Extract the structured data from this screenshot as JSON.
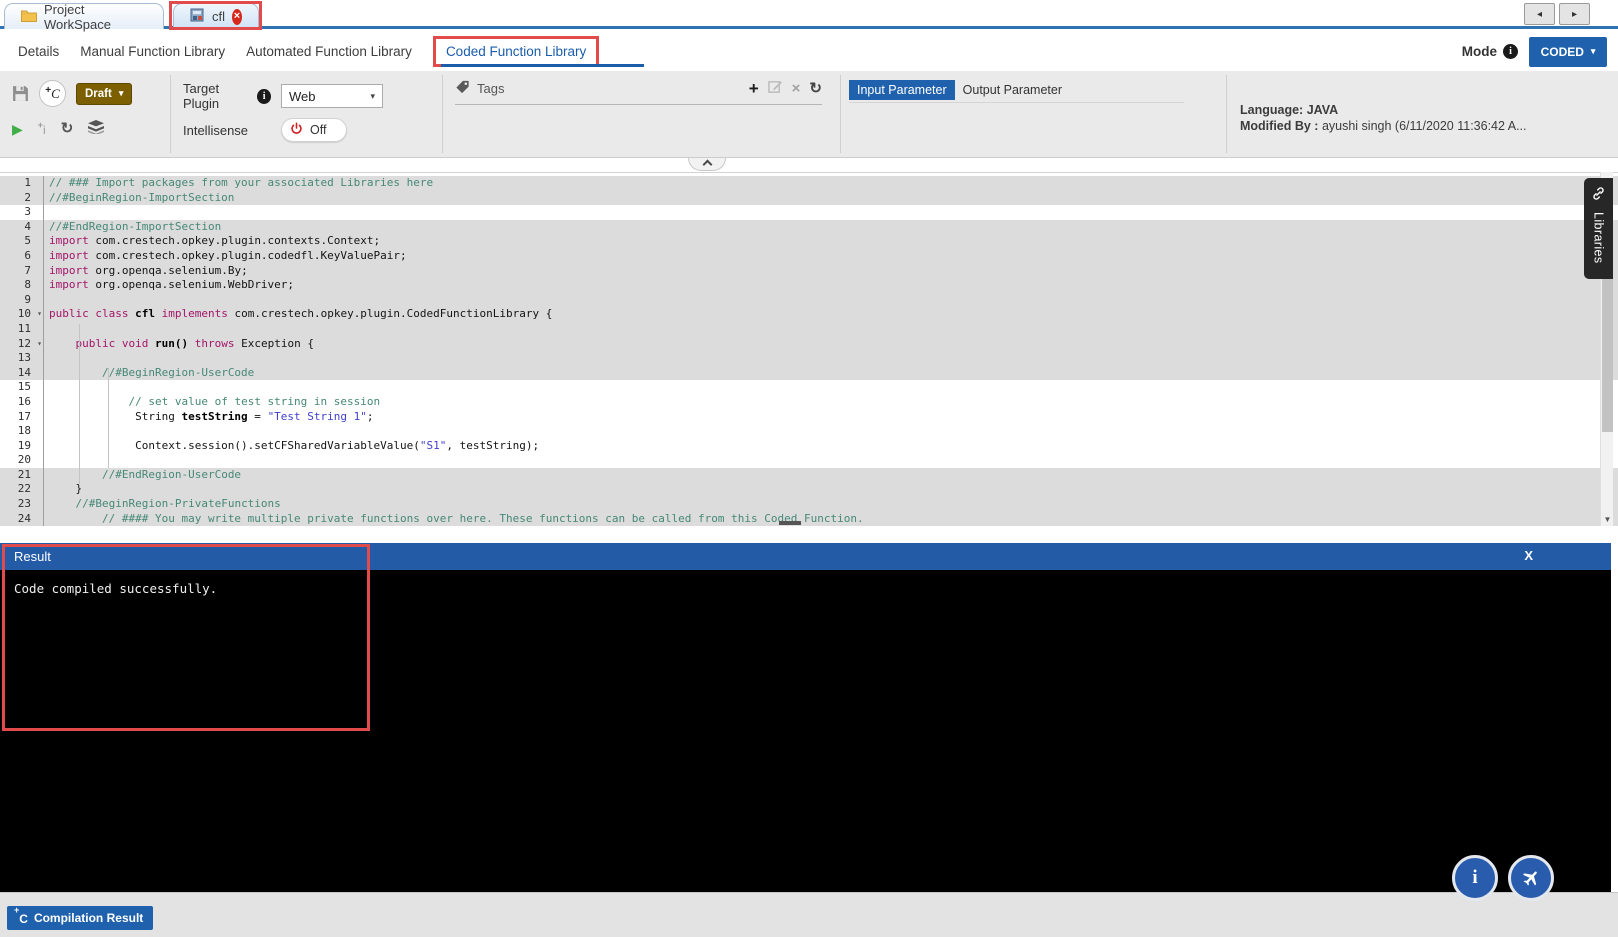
{
  "tab_bar": {
    "workspace_tab": "Project WorkSpace",
    "cfl_tab": "cfl"
  },
  "nav": {
    "items": [
      {
        "label": "Details"
      },
      {
        "label": "Manual Function Library"
      },
      {
        "label": "Automated Function Library"
      },
      {
        "label": "Coded Function Library"
      }
    ],
    "mode_label": "Mode",
    "mode_value": "CODED"
  },
  "toolbar": {
    "draft": "Draft",
    "plus_c": "C",
    "plus_i": "i",
    "target_plugin_label": "Target Plugin",
    "target_plugin_value": "Web",
    "intellisense_label": "Intellisense",
    "intellisense_state": "Off",
    "tags_label": "Tags",
    "input_parameter": "Input Parameter",
    "output_parameter": "Output Parameter",
    "language_label": "Language:",
    "language_value": "JAVA",
    "modified_label": "Modified By :",
    "modified_value": "ayushi singh (6/11/2020 11:36:42 A..."
  },
  "editor": {
    "libraries_tab": "Libraries",
    "lines": [
      {
        "n": 1,
        "s": 1,
        "t": [
          [
            "cm",
            "// ### Import packages from your associated Libraries here"
          ]
        ]
      },
      {
        "n": 2,
        "s": 1,
        "t": [
          [
            "cm",
            "//#BeginRegion-ImportSection"
          ]
        ]
      },
      {
        "n": 3,
        "s": 0,
        "t": []
      },
      {
        "n": 4,
        "s": 1,
        "t": [
          [
            "cm",
            "//#EndRegion-ImportSection"
          ]
        ]
      },
      {
        "n": 5,
        "s": 1,
        "t": [
          [
            "kw",
            "import"
          ],
          [
            "pl",
            " com.crestech.opkey.plugin.contexts.Context;"
          ]
        ]
      },
      {
        "n": 6,
        "s": 1,
        "t": [
          [
            "kw",
            "import"
          ],
          [
            "pl",
            " com.crestech.opkey.plugin.codedfl.KeyValuePair;"
          ]
        ]
      },
      {
        "n": 7,
        "s": 1,
        "t": [
          [
            "kw",
            "import"
          ],
          [
            "pl",
            " org.openqa.selenium.By;"
          ]
        ]
      },
      {
        "n": 8,
        "s": 1,
        "t": [
          [
            "kw",
            "import"
          ],
          [
            "pl",
            " org.openqa.selenium.WebDriver;"
          ]
        ]
      },
      {
        "n": 9,
        "s": 1,
        "t": []
      },
      {
        "n": 10,
        "s": 1,
        "f": 1,
        "t": [
          [
            "kw",
            "public"
          ],
          [
            "pl",
            " "
          ],
          [
            "kw",
            "class"
          ],
          [
            "pl",
            " "
          ],
          [
            "bd",
            "cfl"
          ],
          [
            "pl",
            " "
          ],
          [
            "kw",
            "implements"
          ],
          [
            "pl",
            " com.crestech.opkey.plugin.CodedFunctionLibrary {"
          ]
        ]
      },
      {
        "n": 11,
        "s": 1,
        "t": []
      },
      {
        "n": 12,
        "s": 1,
        "f": 1,
        "t": [
          [
            "pl",
            "    "
          ],
          [
            "kw",
            "public"
          ],
          [
            "pl",
            " "
          ],
          [
            "kw",
            "void"
          ],
          [
            "pl",
            " "
          ],
          [
            "bd",
            "run()"
          ],
          [
            "pl",
            " "
          ],
          [
            "kw",
            "throws"
          ],
          [
            "pl",
            " Exception {"
          ]
        ]
      },
      {
        "n": 13,
        "s": 1,
        "t": []
      },
      {
        "n": 14,
        "s": 1,
        "t": [
          [
            "pl",
            "        "
          ],
          [
            "cm",
            "//#BeginRegion-UserCode"
          ]
        ]
      },
      {
        "n": 15,
        "s": 0,
        "t": []
      },
      {
        "n": 16,
        "s": 0,
        "t": [
          [
            "pl",
            "            "
          ],
          [
            "cm",
            "// set value of test string in session"
          ]
        ]
      },
      {
        "n": 17,
        "s": 0,
        "t": [
          [
            "pl",
            "             String "
          ],
          [
            "bd",
            "testString"
          ],
          [
            "pl",
            " = "
          ],
          [
            "st",
            "\"Test String 1\""
          ],
          [
            "pl",
            ";"
          ]
        ]
      },
      {
        "n": 18,
        "s": 0,
        "t": []
      },
      {
        "n": 19,
        "s": 0,
        "t": [
          [
            "pl",
            "             Context.session().setCFSharedVariableValue("
          ],
          [
            "st",
            "\"S1\""
          ],
          [
            "pl",
            ", testString);"
          ]
        ]
      },
      {
        "n": 20,
        "s": 0,
        "t": []
      },
      {
        "n": 21,
        "s": 1,
        "t": [
          [
            "pl",
            "        "
          ],
          [
            "cm",
            "//#EndRegion-UserCode"
          ]
        ]
      },
      {
        "n": 22,
        "s": 1,
        "t": [
          [
            "pl",
            "    }"
          ]
        ]
      },
      {
        "n": 23,
        "s": 1,
        "t": [
          [
            "pl",
            "    "
          ],
          [
            "cm",
            "//#BeginRegion-PrivateFunctions"
          ]
        ]
      },
      {
        "n": 24,
        "s": 1,
        "t": [
          [
            "pl",
            "        "
          ],
          [
            "cm",
            "// #### You may write multiple private functions over here. These functions can be called from this Coded Function."
          ]
        ]
      }
    ]
  },
  "result": {
    "title": "Result",
    "close": "X",
    "message": "Code compiled successfully."
  },
  "footer": {
    "compilation_button": "Compilation Result"
  },
  "icons": {
    "plus": "+",
    "caret_down": "▾",
    "scroll_left": "◂",
    "scroll_right": "▸",
    "close": "×",
    "refresh": "↻",
    "play": "▶",
    "fold_caret": "▾",
    "scroll_down": "▼",
    "info": "i"
  },
  "colors": {
    "accent_blue": "#1f61ac",
    "result_header_blue": "#245ba7",
    "annotation_red": "#e14b4b",
    "draft_brown": "#7c5f00",
    "code_comment": "#468876",
    "code_keyword": "#a31569",
    "code_string": "#4040cc"
  }
}
